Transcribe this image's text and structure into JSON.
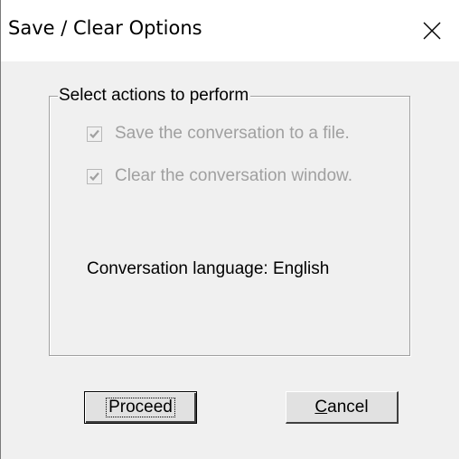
{
  "window": {
    "title": "Save / Clear Options",
    "close_icon": "close-icon"
  },
  "group": {
    "legend": "Select actions to perform",
    "options": [
      {
        "label": "Save the conversation to a file.",
        "checked": true,
        "enabled": false
      },
      {
        "label": "Clear the conversation window.",
        "checked": true,
        "enabled": false
      }
    ],
    "language_text": "Conversation language: English"
  },
  "buttons": {
    "proceed_label": "Proceed",
    "cancel_mnemonic": "C",
    "cancel_rest": "ancel"
  },
  "colors": {
    "window_bg": "#f0f0f0",
    "titlebar_bg": "#ffffff",
    "disabled_text": "#a0a0a0"
  }
}
